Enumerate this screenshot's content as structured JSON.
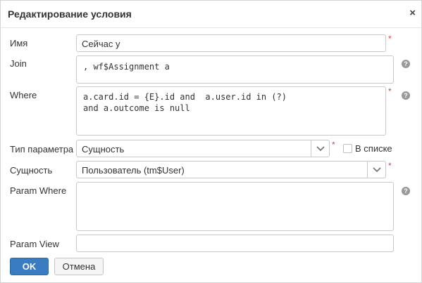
{
  "dialog": {
    "title": "Редактирование условия",
    "close_glyph": "×"
  },
  "form": {
    "name": {
      "label": "Имя",
      "value": "Сейчас у",
      "required_mark": "*"
    },
    "join": {
      "label": "Join",
      "value": ", wf$Assignment a",
      "help": "?"
    },
    "where": {
      "label": "Where",
      "value": "a.card.id = {E}.id and  a.user.id in (?)\nand a.outcome is null",
      "required_mark": "*",
      "help": "?"
    },
    "param_type": {
      "label": "Тип параметра",
      "value": "Сущность",
      "required_mark": "*",
      "checkbox_label": "В списке",
      "checkbox_checked": false
    },
    "entity": {
      "label": "Сущность",
      "value": "Пользователь (tm$User)",
      "required_mark": "*"
    },
    "param_where": {
      "label": "Param Where",
      "value": "",
      "help": "?"
    },
    "param_view": {
      "label": "Param View",
      "value": ""
    }
  },
  "buttons": {
    "ok": "OK",
    "cancel": "Отмена"
  },
  "icons": {
    "close": "close-icon",
    "help": "help-icon",
    "dropdown": "chevron-down-icon",
    "checkbox": "checkbox-icon"
  },
  "colors": {
    "accent": "#3a7cc1",
    "required": "#e04040",
    "help_icon": "#999999"
  }
}
